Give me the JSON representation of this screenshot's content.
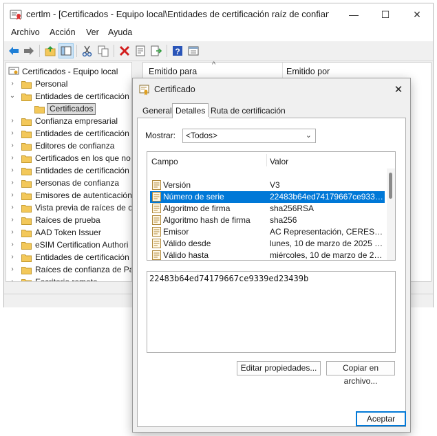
{
  "window": {
    "title": "certlm - [Certificados - Equipo local\\Entidades de certificación raíz de confianza\\Cert…",
    "min": "—",
    "max": "☐",
    "close": "✕"
  },
  "menu": [
    "Archivo",
    "Acción",
    "Ver",
    "Ayuda"
  ],
  "tree": {
    "root": "Certificados - Equipo local",
    "items": [
      {
        "label": "Personal",
        "chevron": "›"
      },
      {
        "label": "Entidades de certificación",
        "chevron": "⌄"
      },
      {
        "label": "Certificados",
        "chevron": ""
      },
      {
        "label": "Confianza empresarial",
        "chevron": "›"
      },
      {
        "label": "Entidades de certificación",
        "chevron": "›"
      },
      {
        "label": "Editores de confianza",
        "chevron": "›"
      },
      {
        "label": "Certificados en los que no",
        "chevron": "›"
      },
      {
        "label": "Entidades de certificación",
        "chevron": "›"
      },
      {
        "label": "Personas de confianza",
        "chevron": "›"
      },
      {
        "label": "Emisores de autenticación",
        "chevron": "›"
      },
      {
        "label": "Vista previa de raíces de c",
        "chevron": "›"
      },
      {
        "label": "Raíces de prueba",
        "chevron": "›"
      },
      {
        "label": "AAD Token Issuer",
        "chevron": "›"
      },
      {
        "label": "eSIM Certification Authori",
        "chevron": "›"
      },
      {
        "label": "Entidades de certificación",
        "chevron": "›"
      },
      {
        "label": "Raíces de confianza de Pa",
        "chevron": "›"
      },
      {
        "label": "Escritorio remoto",
        "chevron": "›"
      }
    ]
  },
  "list": {
    "col_issued_to": "Emitido para",
    "col_issued_by": "Emitido por",
    "sort_arrow": "^"
  },
  "dialog": {
    "title": "Certificado",
    "close": "✕",
    "tabs": [
      "General",
      "Detalles",
      "Ruta de certificación"
    ],
    "show_label": "Mostrar:",
    "show_value": "<Todos>",
    "col_field": "Campo",
    "col_value": "Valor",
    "fields": [
      {
        "name": "Versión",
        "value": "V3"
      },
      {
        "name": "Número de serie",
        "value": "22483b64ed74179667ce9339…"
      },
      {
        "name": "Algoritmo de firma",
        "value": "sha256RSA"
      },
      {
        "name": "Algoritmo hash de firma",
        "value": "sha256"
      },
      {
        "name": "Emisor",
        "value": "AC Representación, CERES, F…"
      },
      {
        "name": "Válido desde",
        "value": "lunes, 10 de marzo de 2025 8:…"
      },
      {
        "name": "Válido hasta",
        "value": "miércoles, 10 de marzo de 202…"
      }
    ],
    "selected_value": "22483b64ed74179667ce9339ed23439b",
    "edit_button": "Editar propiedades...",
    "copy_button": "Copiar en archivo...",
    "ok_button": "Aceptar"
  },
  "colors": {
    "accent": "#0078d7",
    "folder": "#f3c85a"
  }
}
